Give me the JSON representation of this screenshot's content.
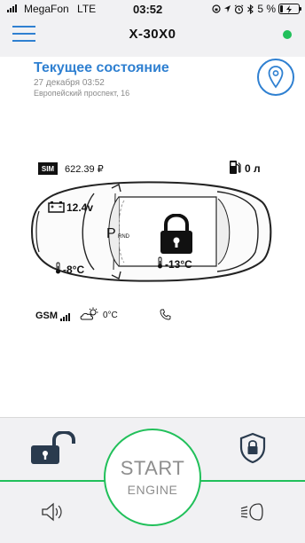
{
  "status_bar": {
    "carrier": "MegaFon",
    "network": "LTE",
    "time": "03:52",
    "battery_percent": "5 %"
  },
  "header": {
    "title": "X-30X0",
    "online_color": "#21c05a"
  },
  "state": {
    "heading": "Текущее состояние",
    "datetime": "27 декабря 03:52",
    "address": "Европейский проспект, 16"
  },
  "vehicle": {
    "sim_label": "SIM",
    "balance": "622.39 ₽",
    "fuel": "0 л",
    "voltage": "12.4v",
    "gear": "P",
    "gear_sub": "RND",
    "outside_temp": "-8°C",
    "cabin_temp": "-13°C",
    "gsm_label": "GSM",
    "weather_temp": "0°C",
    "locked": true
  },
  "controls": {
    "start_label": "START",
    "engine_label": "ENGINE"
  },
  "colors": {
    "accent": "#2f80d1",
    "green": "#21c05a"
  },
  "icons": [
    "menu-icon",
    "map-pin-icon",
    "fuel-icon",
    "car-battery-icon",
    "padlock-icon",
    "thermometer-icon",
    "weather-icon",
    "phone-icon",
    "unlock-icon",
    "shield-lock-icon",
    "horn-icon",
    "headlight-icon"
  ]
}
